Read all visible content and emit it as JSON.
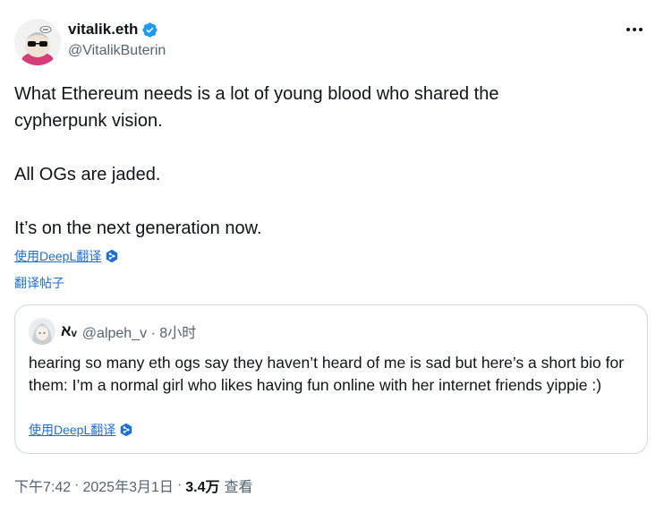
{
  "author": {
    "display_name": "vitalik.eth",
    "handle": "@VitalikButerin",
    "verified_color": "#1d9bf0",
    "avatar_icon": "avatar-cartoon-icon"
  },
  "tweet": {
    "lines": [
      "What Ethereum needs is a lot of young blood who shared the",
      "cypherpunk vision.",
      "All OGs are jaded.",
      "It’s on the next generation now."
    ]
  },
  "translate": {
    "deepl_label": "使用DeepL翻译",
    "post_label": "翻译帖子",
    "link_color": "#1d6fd1"
  },
  "quote": {
    "display_name": "אᵥ",
    "handle_time": "@alpeh_v · 8小时",
    "text": "hearing so many eth ogs say they haven’t heard of me is sad but here’s a short bio for them: I’m a normal girl who likes having fun online with her internet friends yippie :)",
    "deepl_label": "使用DeepL翻译"
  },
  "footer": {
    "time": "下午7:42",
    "date": "2025年3月1日",
    "views": "3.4万",
    "views_label": "查看"
  }
}
